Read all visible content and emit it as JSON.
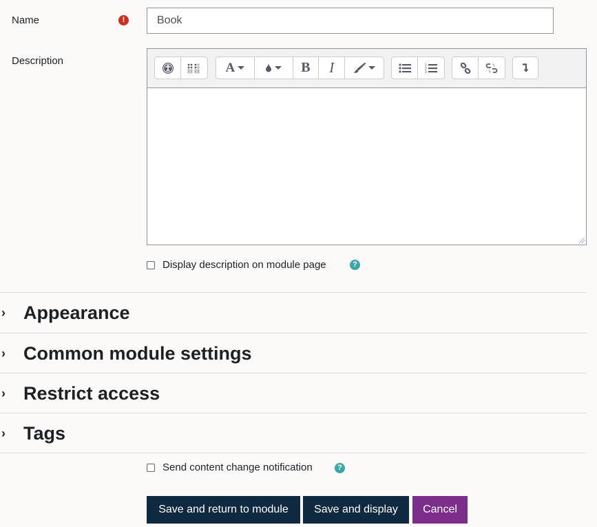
{
  "form": {
    "name_label": "Name",
    "name_value": "Book",
    "required_icon": "exclamation-circle-icon",
    "description_label": "Description",
    "description_value": "",
    "display_description_label": "Display description on module page",
    "display_description_checked": false
  },
  "toolbar": {
    "groups": [
      {
        "buttons": [
          "accessibility-checker-icon",
          "screenreader-helper-icon"
        ]
      },
      {
        "buttons": [
          "font-style-icon",
          "font-color-icon",
          "bold-icon",
          "italic-icon",
          "clear-formatting-icon"
        ]
      },
      {
        "buttons": [
          "unordered-list-icon",
          "ordered-list-icon"
        ]
      },
      {
        "buttons": [
          "link-icon",
          "unlink-icon"
        ]
      },
      {
        "buttons": [
          "show-more-icon"
        ]
      }
    ]
  },
  "sections": [
    {
      "title": "Appearance"
    },
    {
      "title": "Common module settings"
    },
    {
      "title": "Restrict access"
    },
    {
      "title": "Tags"
    }
  ],
  "notification": {
    "label": "Send content change notification",
    "checked": false
  },
  "buttons": {
    "save_return": "Save and return to module",
    "save_display": "Save and display",
    "cancel": "Cancel"
  },
  "colors": {
    "primary": "#0f2a40",
    "cancel": "#7b2e8a",
    "required": "#ca3120",
    "help": "#3aa6a6"
  }
}
